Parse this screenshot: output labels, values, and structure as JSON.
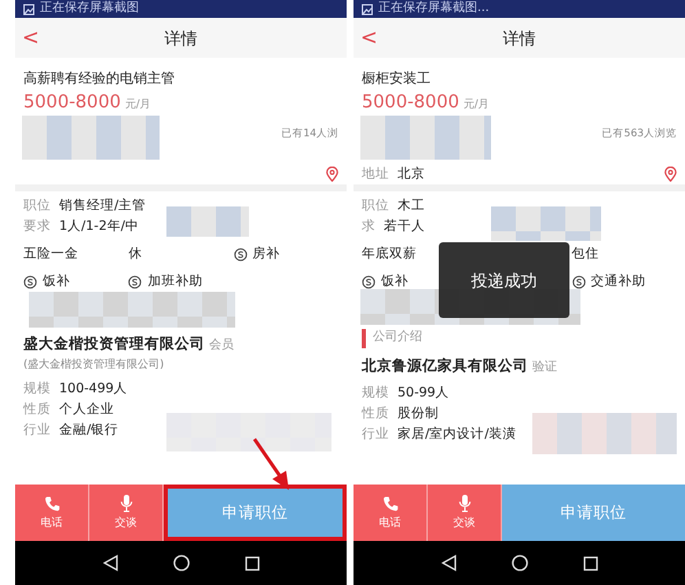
{
  "screens": [
    {
      "status_text": "正在保存屏幕截图",
      "back": "<",
      "title": "详情",
      "job_title": "高薪聘有经验的电销主管",
      "salary": "5000-8000",
      "salary_unit": "元/月",
      "views": "已有14人浏",
      "fields": [
        {
          "label": "职位",
          "value": "销售经理/主管"
        },
        {
          "label": "要求",
          "value": "1人/1-2年/中"
        }
      ],
      "perks": [
        {
          "text": "五险一金",
          "icon": false
        },
        {
          "text": "休",
          "icon": false
        },
        {
          "text": "房补",
          "icon": true
        },
        {
          "text": "饭补",
          "icon": true
        },
        {
          "text": "加班补助",
          "icon": true
        }
      ],
      "company": {
        "name": "盛大金楷投资管理有限公司",
        "badge": "会员",
        "subname": "(盛大金楷投资管理有限公司)"
      },
      "company_fields": [
        {
          "label": "规模",
          "value": "100-499人"
        },
        {
          "label": "性质",
          "value": "个人企业"
        },
        {
          "label": "行业",
          "value": "金融/银行"
        }
      ],
      "actions": [
        {
          "label": "电话",
          "kind": "phone"
        },
        {
          "label": "交谈",
          "kind": "mic"
        }
      ],
      "apply": {
        "label": "申请职位",
        "highlighted": true
      }
    },
    {
      "status_text": "正在保存屏幕截图...",
      "back": "<",
      "title": "详情",
      "job_title": "橱柜安装工",
      "salary": "5000-8000",
      "salary_unit": "元/月",
      "views": "已有563人浏览",
      "address": {
        "label": "地址",
        "value": "北京"
      },
      "fields": [
        {
          "label": "职位",
          "value": "木工"
        },
        {
          "label": "求",
          "value": "若干人"
        }
      ],
      "perks": [
        {
          "text": "年底双薪",
          "icon": false
        },
        {
          "text": "包住",
          "icon": false
        },
        {
          "text": "饭补",
          "icon": true
        },
        {
          "text": "交通补助",
          "icon": true
        }
      ],
      "company": {
        "section_title": "公司介绍",
        "name": "北京鲁源亿家具有限公司",
        "badge": "验证"
      },
      "company_fields": [
        {
          "label": "规模",
          "value": "50-99人"
        },
        {
          "label": "性质",
          "value": "股份制"
        },
        {
          "label": "行业",
          "value": "家居/室内设计/装潢"
        }
      ],
      "actions": [
        {
          "label": "电话",
          "kind": "phone"
        },
        {
          "label": "交谈",
          "kind": "mic"
        }
      ],
      "apply": {
        "label": "申请职位",
        "highlighted": false
      },
      "toast": "投递成功"
    }
  ]
}
